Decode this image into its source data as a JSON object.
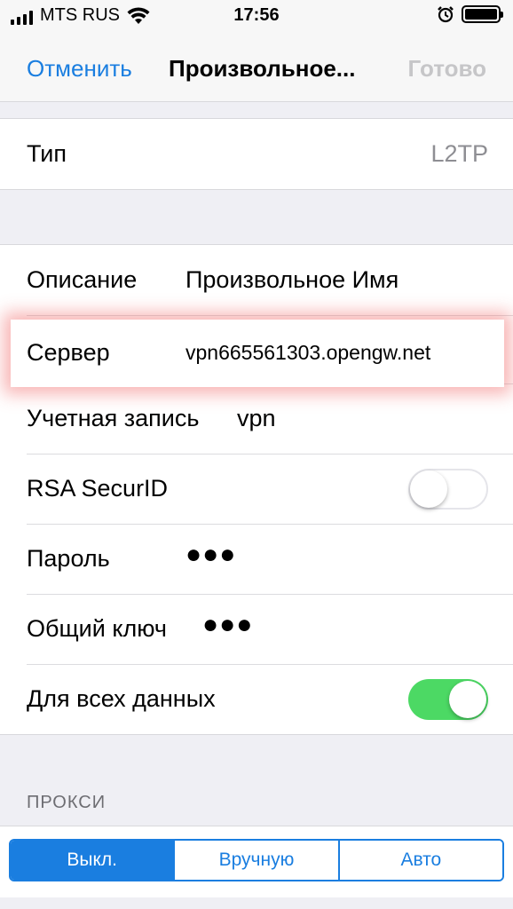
{
  "status_bar": {
    "carrier": "MTS RUS",
    "time": "17:56"
  },
  "nav": {
    "cancel_label": "Отменить",
    "title": "Произвольное...",
    "done_label": "Готово"
  },
  "type_row": {
    "label": "Тип",
    "value": "L2TP"
  },
  "settings": {
    "description": {
      "label": "Описание",
      "value": "Произвольное Имя"
    },
    "server": {
      "label": "Сервер",
      "value": "vpn665561303.opengw.net"
    },
    "account": {
      "label": "Учетная запись",
      "value": "vpn"
    },
    "rsa": {
      "label": "RSA SecurID",
      "enabled": false
    },
    "password": {
      "label": "Пароль",
      "value": "●●●"
    },
    "shared_key": {
      "label": "Общий ключ",
      "value": "●●●"
    },
    "send_all": {
      "label": "Для всех данных",
      "enabled": true
    }
  },
  "proxy": {
    "header": "ПРОКСИ",
    "options": [
      "Выкл.",
      "Вручную",
      "Авто"
    ],
    "selected": "Выкл."
  },
  "colors": {
    "accent": "#1a7ee0",
    "toggle_on": "#4cd964",
    "highlight_glow": "#f05a5a"
  }
}
